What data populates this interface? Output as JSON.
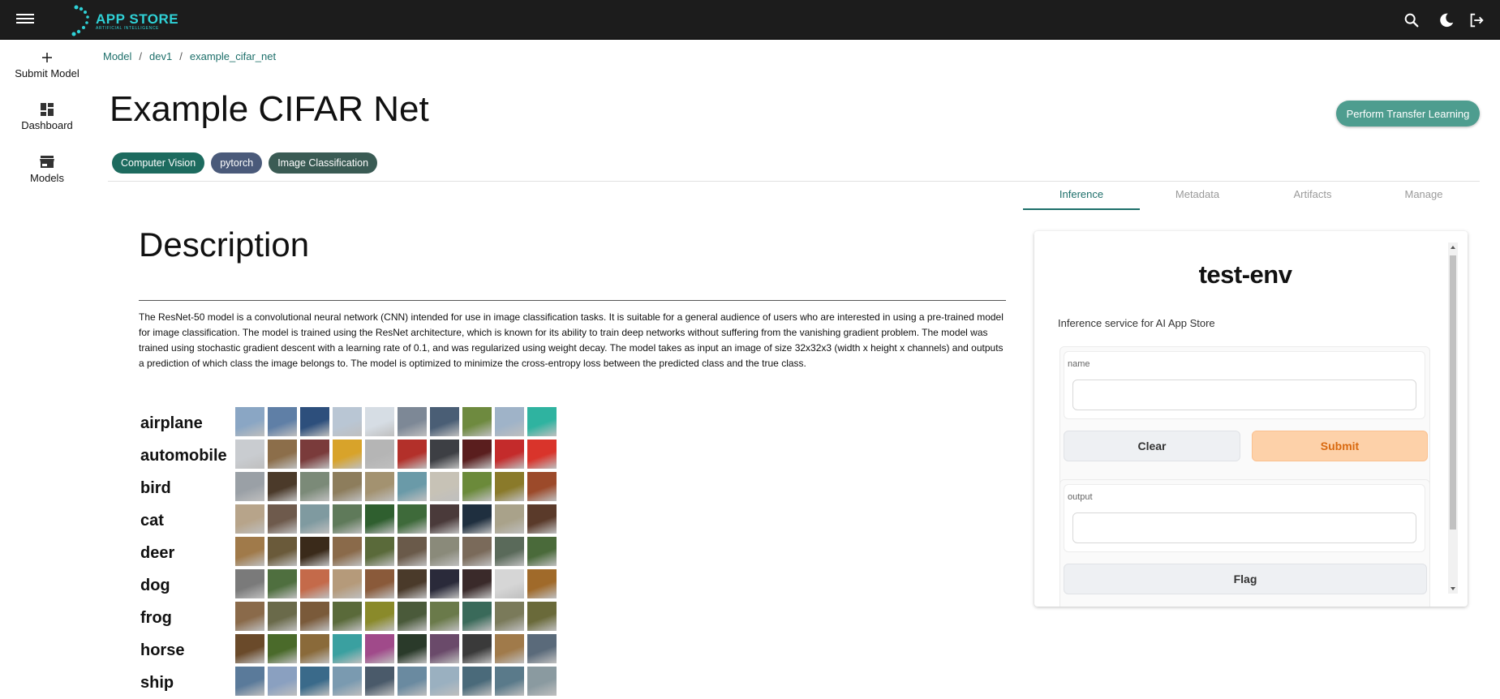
{
  "topbar": {
    "app_name": "APP STORE",
    "app_subtitle": "ARTIFICIAL INTELLIGENCE",
    "icons": [
      "menu-icon",
      "search-icon",
      "dark-mode-icon",
      "logout-icon"
    ]
  },
  "sidebar": {
    "items": [
      {
        "label": "Submit Model",
        "icon": "plus-icon"
      },
      {
        "label": "Dashboard",
        "icon": "dashboard-icon"
      },
      {
        "label": "Models",
        "icon": "store-icon"
      }
    ]
  },
  "breadcrumb": [
    "Model",
    "dev1",
    "example_cifar_net"
  ],
  "page": {
    "title": "Example CIFAR Net",
    "transfer_button": "Perform Transfer Learning",
    "tags": [
      {
        "label": "Computer Vision",
        "color": "#1d6b5f"
      },
      {
        "label": "pytorch",
        "color": "#4a5a7a"
      },
      {
        "label": "Image Classification",
        "color": "#3a5b54"
      }
    ]
  },
  "tabs": [
    {
      "label": "Inference",
      "active": true
    },
    {
      "label": "Metadata",
      "active": false
    },
    {
      "label": "Artifacts",
      "active": false
    },
    {
      "label": "Manage",
      "active": false
    }
  ],
  "description": {
    "heading": "Description",
    "text": "The ResNet-50 model is a convolutional neural network (CNN) intended for use in image classification tasks. It is suitable for a general audience of users who are interested in using a pre-trained model for image classification. The model is trained using the ResNet architecture, which is known for its ability to train deep networks without suffering from the vanishing gradient problem. The model was trained using stochastic gradient descent with a learning rate of 0.1, and was regularized using weight decay. The model takes as input an image of size 32x32x3 (width x height x channels) and outputs a prediction of which class the image belongs to. The model is optimized to minimize the cross-entropy loss between the predicted class and the true class.",
    "classes": [
      "airplane",
      "automobile",
      "bird",
      "cat",
      "deer",
      "dog",
      "frog",
      "horse",
      "ship"
    ]
  },
  "inference_panel": {
    "title": "test-env",
    "description": "Inference service for AI App Store",
    "input_label": "name",
    "input_value": "",
    "clear_button": "Clear",
    "submit_button": "Submit",
    "output_label": "output",
    "output_value": "",
    "flag_button": "Flag"
  },
  "colors": {
    "accent": "#1d6f6a",
    "topbar": "#1c1c1c",
    "logo": "#2fd1d6",
    "submit_bg": "#fdd1a9",
    "submit_text": "#d9690f"
  }
}
